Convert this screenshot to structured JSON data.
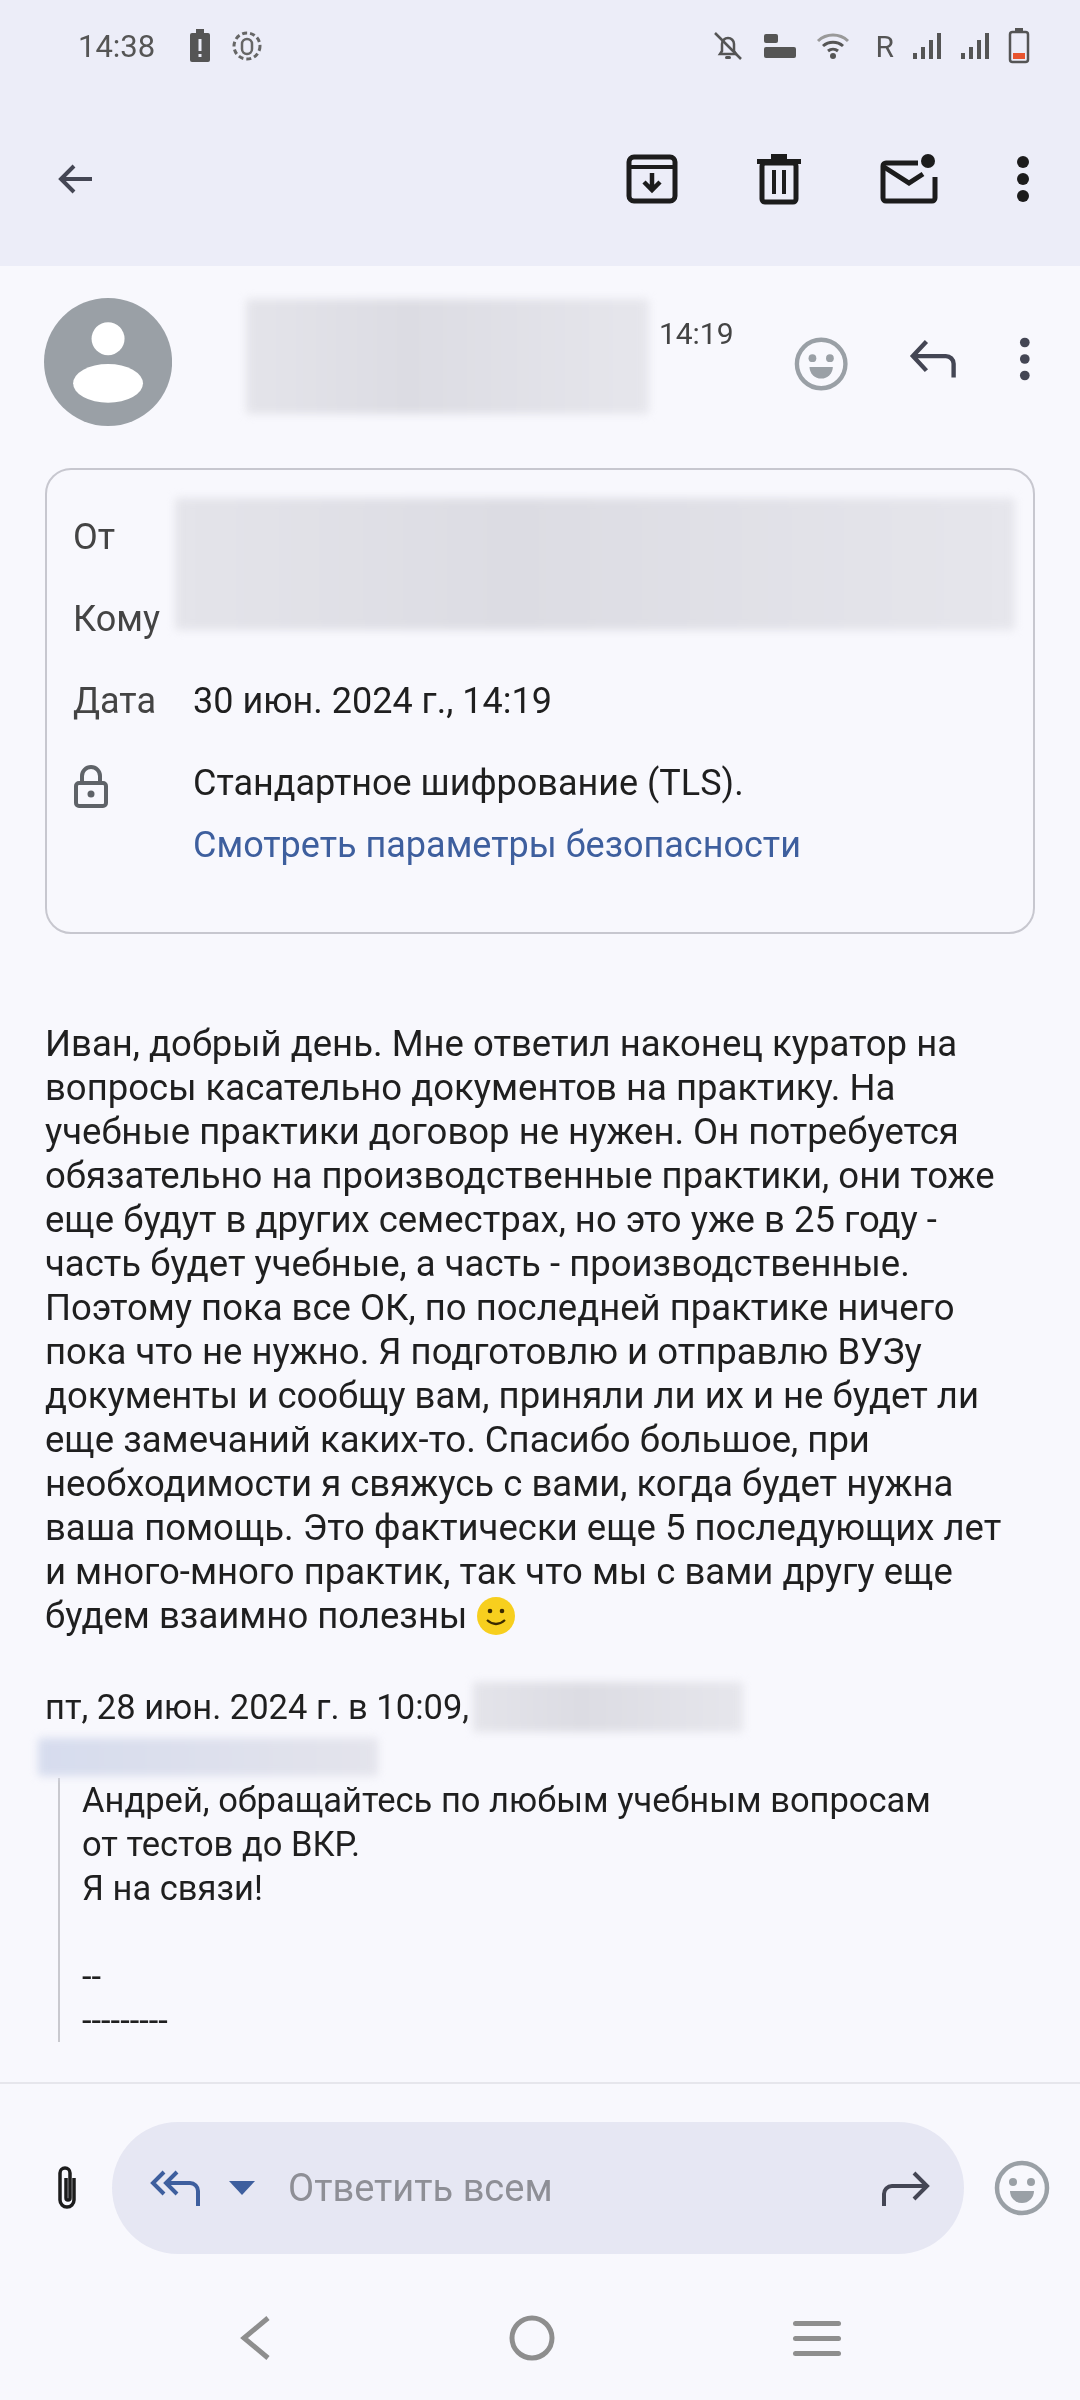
{
  "status_bar": {
    "time": "14:38",
    "roaming": "R"
  },
  "message": {
    "time": "14:19",
    "details": {
      "from_label": "От",
      "to_label": "Кому",
      "date_label": "Дата",
      "date": "30 июн. 2024 г., 14:19",
      "encryption": "Стандартное шифрование (TLS).",
      "security_link": "Смотреть параметры безопасности"
    },
    "body": "Иван, добрый день. Мне ответил наконец куратор на вопросы касательно документов на практику. На учебные практики договор не нужен. Он потребуется обязательно на производственные практики, они тоже еще будут в других семестрах, но это уже в 25 году - часть будет учебные, а часть - производственные. Поэтому пока все ОК, по последней практике ничего пока что не нужно. Я подготовлю и отправлю ВУЗу документы и сообщу вам, приняли ли их и не будет ли еще замечаний каких-то. Спасибо большое, при необходимости я свяжусь с вами, когда будет нужна ваша помощь. Это фактически еще 5 последующих лет и много-много практик, так что мы с вами другу еще будем взаимно полезны",
    "quote_header": "пт, 28 июн. 2024 г. в 10:09,",
    "quoted_paragraphs": [
      [
        "Андрей, обращайтесь по любым учебным вопросам",
        "от тестов до ВКР.",
        "Я на связи!"
      ],
      [
        "--",
        "---------"
      ]
    ]
  },
  "compose": {
    "placeholder": "Ответить всем"
  }
}
